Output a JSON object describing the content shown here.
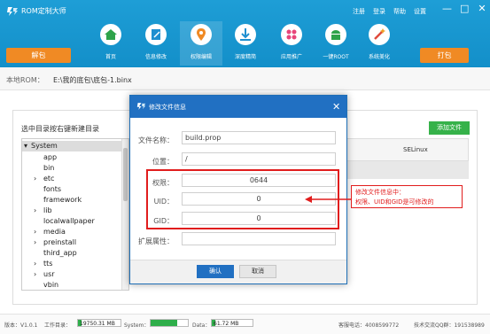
{
  "app": {
    "title": "ROM定制大师"
  },
  "top_links": [
    "注册",
    "登录",
    "帮助",
    "设置"
  ],
  "window_controls": {
    "minimize": "—",
    "maximize": "□",
    "close": "✕"
  },
  "tabs": [
    {
      "label": "首页",
      "icon": "home-icon"
    },
    {
      "label": "信息修改",
      "icon": "edit-icon"
    },
    {
      "label": "权限编辑",
      "icon": "location-pin-icon",
      "active": true
    },
    {
      "label": "深度精简",
      "icon": "download-icon"
    },
    {
      "label": "应用推广",
      "icon": "apps-icon"
    },
    {
      "label": "一键ROOT",
      "icon": "android-icon"
    },
    {
      "label": "系统美化",
      "icon": "magic-wand-icon"
    }
  ],
  "buttons": {
    "unpack": "解包",
    "pack": "打包",
    "add_file": "添加文件"
  },
  "rom": {
    "label": "本地ROM：",
    "path": "E:\\我的底包\\底包-1.binx"
  },
  "tree": {
    "title": "选中目录按右键新建目录",
    "root": "System",
    "items": [
      "app",
      "bin",
      "etc",
      "fonts",
      "framework",
      "lib",
      "localwallpaper",
      "media",
      "preinstall",
      "third_app",
      "tts",
      "usr",
      "vbin"
    ]
  },
  "table": {
    "col_selinux": "SELinux"
  },
  "dialog": {
    "title": "修改文件信息",
    "close": "✕",
    "fields": {
      "filename": {
        "label": "文件名称：",
        "value": "build.prop"
      },
      "location": {
        "label": "位置：",
        "value": "/"
      },
      "permission": {
        "label": "权限：",
        "value": "0644"
      },
      "uid": {
        "label": "UID：",
        "value": "0"
      },
      "gid": {
        "label": "GID：",
        "value": "0"
      },
      "ext_attr": {
        "label": "扩展属性：",
        "value": ""
      }
    },
    "ok": "确认",
    "cancel": "取消"
  },
  "annotation": {
    "line1": "修改文件信息中：",
    "line2": "权限、UID和GID是可修改的"
  },
  "status": {
    "version": "版本：V1.0.1",
    "workdir_label": "工作目录：",
    "workdir_value": "19750.31 MB",
    "system_label": "System：",
    "system_value": "",
    "data_label": "Data：",
    "data_value": "61.72 MB",
    "hotline": "客服电话：4008599772",
    "qq_group": "技术交流QQ群：191538989"
  },
  "colors": {
    "header": "#1a97d0",
    "accent_orange": "#f08a24",
    "green": "#36b24a",
    "dialog_blue": "#2170c2",
    "annotation_red": "#e11d1d"
  }
}
